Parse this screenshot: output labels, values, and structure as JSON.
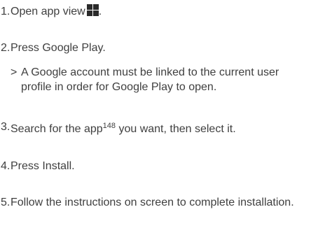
{
  "steps": [
    {
      "number": "1.",
      "text": "Open app view",
      "icon": "app-view-grid-icon",
      "end": "."
    },
    {
      "number": "2.",
      "text": "Press Google Play."
    },
    {
      "number": "3.",
      "text_before": "Search for the app",
      "superscript": "148",
      "text_after": " you want, then select it."
    },
    {
      "number": "4.",
      "text": "Press Install."
    },
    {
      "number": "5.",
      "text": "Follow the instructions on screen to complete installation."
    }
  ],
  "note": {
    "marker": ">",
    "text": "A Google account must be linked to the current user profile in order for Google Play to open."
  }
}
